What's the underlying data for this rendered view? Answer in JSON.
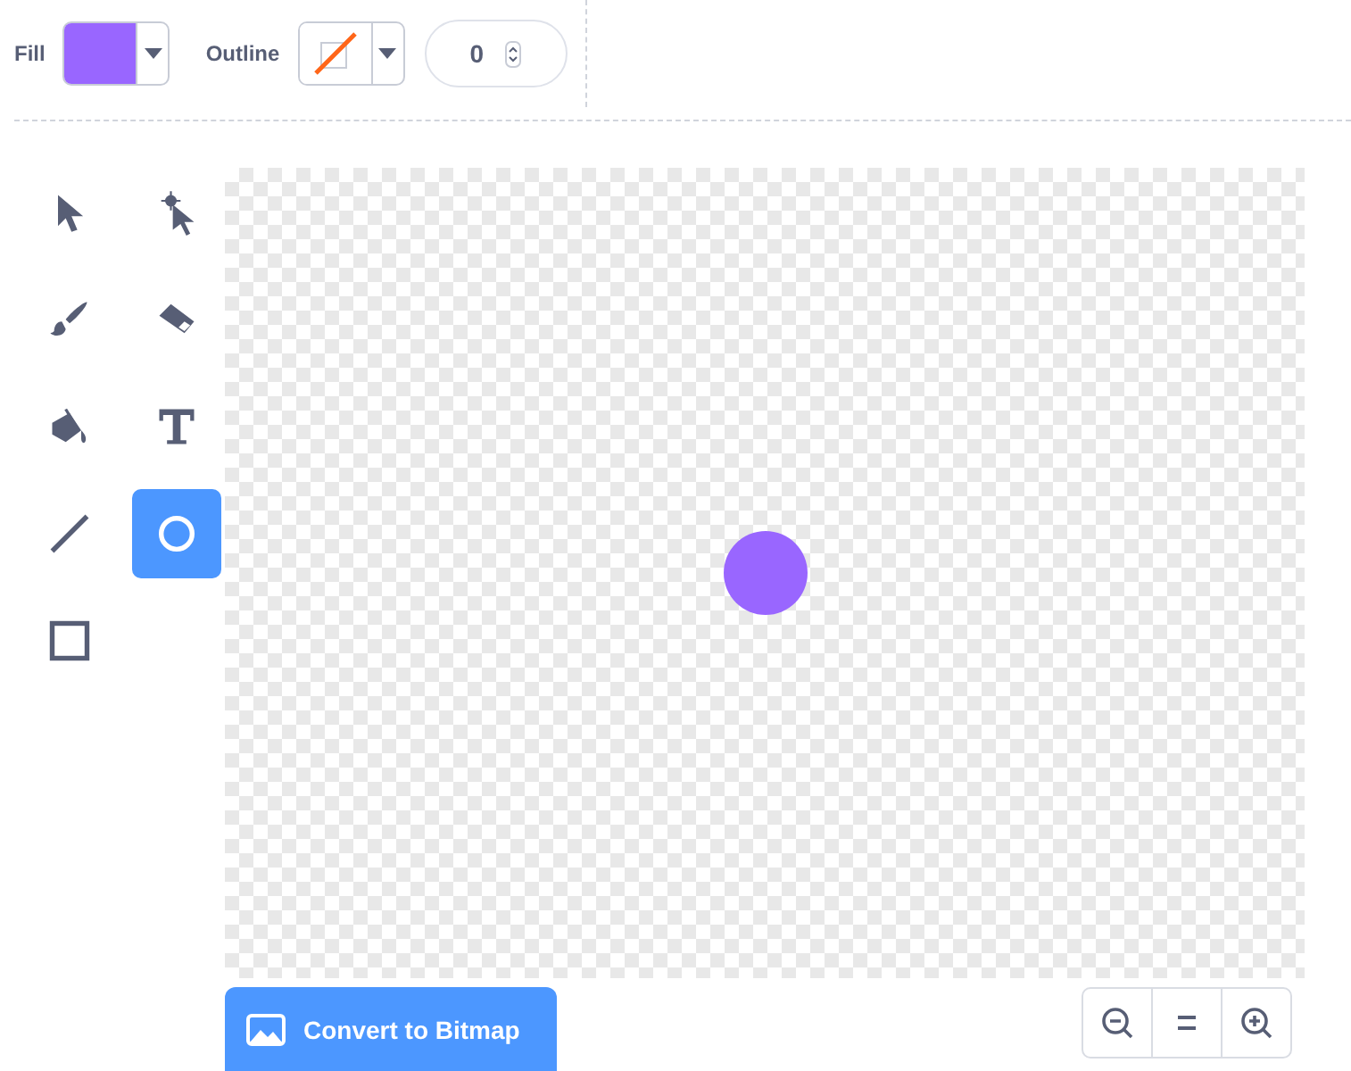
{
  "fill": {
    "label": "Fill",
    "color": "#9966ff"
  },
  "outline": {
    "label": "Outline",
    "kind": "none"
  },
  "outline_width": {
    "value": "0"
  },
  "tools": [
    {
      "kind": "select",
      "selected": false
    },
    {
      "kind": "reshape",
      "selected": false
    },
    {
      "kind": "brush",
      "selected": false
    },
    {
      "kind": "eraser",
      "selected": false
    },
    {
      "kind": "fill",
      "selected": false
    },
    {
      "kind": "text",
      "selected": false
    },
    {
      "kind": "line",
      "selected": false
    },
    {
      "kind": "circle",
      "selected": true
    },
    {
      "kind": "rect",
      "selected": false
    }
  ],
  "canvas": {
    "shapes": [
      {
        "kind": "circle",
        "color": "#9966ff"
      }
    ]
  },
  "convert_button": {
    "label": "Convert to Bitmap"
  },
  "zoom_controls": [
    {
      "kind": "zoom-out"
    },
    {
      "kind": "reset"
    },
    {
      "kind": "zoom-in"
    }
  ]
}
